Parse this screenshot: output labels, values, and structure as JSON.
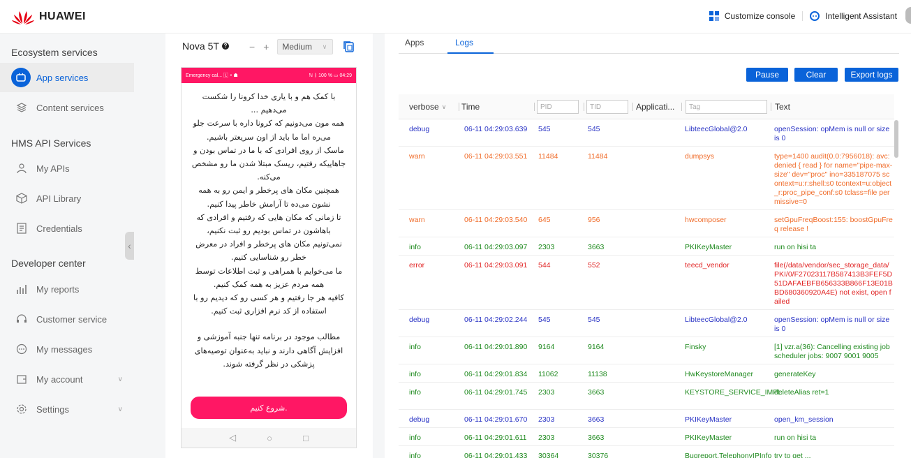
{
  "header": {
    "brand": "HUAWEI",
    "customize": "Customize console",
    "assistant": "Intelligent Assistant",
    "accent": "#0a63d9"
  },
  "sidebar": {
    "groups": [
      {
        "label": "Ecosystem services"
      },
      {
        "label": "HMS API Services"
      },
      {
        "label": "Developer center"
      }
    ],
    "items": [
      {
        "label": "App services",
        "icon": "app-services-icon"
      },
      {
        "label": "Content services",
        "icon": "content-services-icon"
      },
      {
        "label": "My APIs",
        "icon": "api-icon"
      },
      {
        "label": "API Library",
        "icon": "api-library-icon"
      },
      {
        "label": "Credentials",
        "icon": "credentials-icon"
      },
      {
        "label": "My reports",
        "icon": "reports-icon"
      },
      {
        "label": "Customer service",
        "icon": "customer-service-icon"
      },
      {
        "label": "My messages",
        "icon": "messages-icon"
      },
      {
        "label": "My account",
        "icon": "account-icon"
      },
      {
        "label": "Settings",
        "icon": "settings-icon"
      }
    ]
  },
  "device": {
    "name": "Nova 5T",
    "help": "?",
    "zoom_minus": "−",
    "zoom_plus": "+",
    "zoom_value": "Medium",
    "status_left": "Emergency cal... 🄻 ⁌ ☗",
    "status_right": "ℕ ᛒ 100 % ▭ 04:29",
    "content_lines": [
      "با کمک هم و با یاری خدا کرونا را شکست می‌دهیم ...",
      "همه مون می‌دونیم که کرونا داره با سرعت جلو می‌ره اما ما باید از اون سریعتر باشیم.",
      "ماسک از روی افرادی که با ما در تماس بودن و جاهاییکه رفتیم، ریسک مبتلا شدن ما رو مشخص می‌کنه.",
      "همچنین مکان های پرخطر و ایمن رو به همه نشون می‌ده تا آرامش خاطر پیدا کنیم.",
      "تا زمانی که مکان هایی که رفتیم و افرادی که باهاشون در تماس بودیم رو ثبت نکنیم، نمی‌تونیم مکان های پرخطر و افراد در معرض خطر رو شناسایی کنیم.",
      "ما می‌خوایم با همراهی و ثبت اطلاعات توسط همه مردم عزیز به همه کمک کنیم.",
      "کافیه هر جا رفتیم و هر کسی رو که دیدیم رو با استفاده از کد نرم افزاری ثبت کنیم."
    ],
    "disclaimer": "مطالب موجود در برنامه تنها جنبه آموزشی و افزایش آگاهی دارند و نباید به‌عنوان توصیه‌های پزشکی در نظر گرفته شوند.",
    "start_button": "شروع کنیم.",
    "nav_back": "◁",
    "nav_home": "○",
    "nav_recent": "□"
  },
  "logs": {
    "tabs": [
      {
        "label": "Apps"
      },
      {
        "label": "Logs"
      }
    ],
    "buttons": {
      "pause": "Pause",
      "clear": "Clear",
      "export": "Export logs"
    },
    "columns": {
      "level": "verbose",
      "time": "Time",
      "pid": "PID",
      "tid": "TID",
      "application": "Applicati...",
      "tag": "Tag",
      "text": "Text"
    },
    "rows": [
      {
        "level": "debug",
        "time": "06-11 04:29:03.639",
        "pid": "545",
        "tid": "545",
        "app": "",
        "tag": "LibteecGlobal@2.0",
        "text": "openSession: opMem is null or size is 0"
      },
      {
        "level": "warn",
        "time": "06-11 04:29:03.551",
        "pid": "11484",
        "tid": "11484",
        "app": "",
        "tag": "dumpsys",
        "text": "type=1400 audit(0.0:7956018): avc: denied { read } for name=\"pipe-max-size\" dev=\"proc\" ino=335187075 scontext=u:r:shell:s0 tcontext=u:object_r:proc_pipe_conf:s0 tclass=file permissive=0"
      },
      {
        "level": "warn",
        "time": "06-11 04:29:03.540",
        "pid": "645",
        "tid": "956",
        "app": "",
        "tag": "hwcomposer",
        "text": "setGpuFreqBoost:155: boostGpuFreq release !"
      },
      {
        "level": "info",
        "time": "06-11 04:29:03.097",
        "pid": "2303",
        "tid": "3663",
        "app": "",
        "tag": "PKIKeyMaster",
        "text": "run on hisi ta"
      },
      {
        "level": "error",
        "time": "06-11 04:29:03.091",
        "pid": "544",
        "tid": "552",
        "app": "",
        "tag": "teecd_vendor",
        "text": "file(/data/vendor/sec_storage_data/PKI/0/F27023117B587413B3FEF5D51DAFAEBFB656333B866F13E01BBD680360920A4E) not exist, open failed"
      },
      {
        "level": "debug",
        "time": "06-11 04:29:02.244",
        "pid": "545",
        "tid": "545",
        "app": "",
        "tag": "LibteecGlobal@2.0",
        "text": "openSession: opMem is null or size is 0"
      },
      {
        "level": "info",
        "time": "06-11 04:29:01.890",
        "pid": "9164",
        "tid": "9164",
        "app": "",
        "tag": "Finsky",
        "text": "[1] vzr.a(36): Cancelling existing jobscheduler jobs: 9007 9001 9005"
      },
      {
        "level": "info",
        "time": "06-11 04:29:01.834",
        "pid": "11062",
        "tid": "11138",
        "app": "",
        "tag": "HwKeystoreManager",
        "text": "generateKey"
      },
      {
        "level": "info",
        "time": "06-11 04:29:01.745",
        "pid": "2303",
        "tid": "3663",
        "app": "",
        "tag": "KEYSTORE_SERVICE_IMPL",
        "text": "deleteAlias ret=1"
      },
      {
        "level": "debug",
        "time": "06-11 04:29:01.670",
        "pid": "2303",
        "tid": "3663",
        "app": "",
        "tag": "PKIKeyMaster",
        "text": "open_km_session"
      },
      {
        "level": "info",
        "time": "06-11 04:29:01.611",
        "pid": "2303",
        "tid": "3663",
        "app": "",
        "tag": "PKIKeyMaster",
        "text": "run on hisi ta"
      },
      {
        "level": "info",
        "time": "06-11 04:29:01.433",
        "pid": "30364",
        "tid": "30376",
        "app": "",
        "tag": "Bugreport.TelephonyIPInfo",
        "text": "try to get ..."
      }
    ]
  }
}
